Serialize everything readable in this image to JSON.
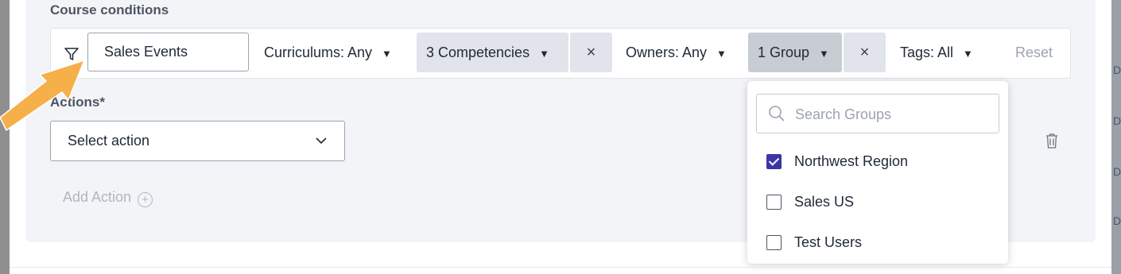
{
  "section": {
    "course_conditions_label": "Course conditions"
  },
  "filters": {
    "search_value": "Sales Events",
    "curriculums_label": "Curriculums: Any",
    "competencies_label": "3 Competencies",
    "owners_label": "Owners: Any",
    "group_label": "1 Group",
    "tags_label": "Tags: All",
    "reset_label": "Reset",
    "clear_glyph": "×",
    "caret_glyph": "▼"
  },
  "actions": {
    "label": "Actions*",
    "select_placeholder": "Select action",
    "add_action_label": "Add Action",
    "plus_glyph": "+"
  },
  "group_dropdown": {
    "search_placeholder": "Search Groups",
    "options": [
      {
        "label": "Northwest Region",
        "checked": true
      },
      {
        "label": "Sales US",
        "checked": false
      },
      {
        "label": "Test Users",
        "checked": false
      }
    ]
  },
  "colors": {
    "accent_checkbox": "#3b36a8",
    "highlight_arrow": "#f5b04a",
    "panel_bg": "#f3f4f8",
    "chip_bg": "#e1e4ea",
    "chip_active_bg": "#c8ccd3"
  },
  "icons": [
    "filter-icon",
    "search-icon",
    "trash-icon",
    "chevron-down-icon",
    "close-icon",
    "plus-circle-icon",
    "annotation-arrow"
  ]
}
